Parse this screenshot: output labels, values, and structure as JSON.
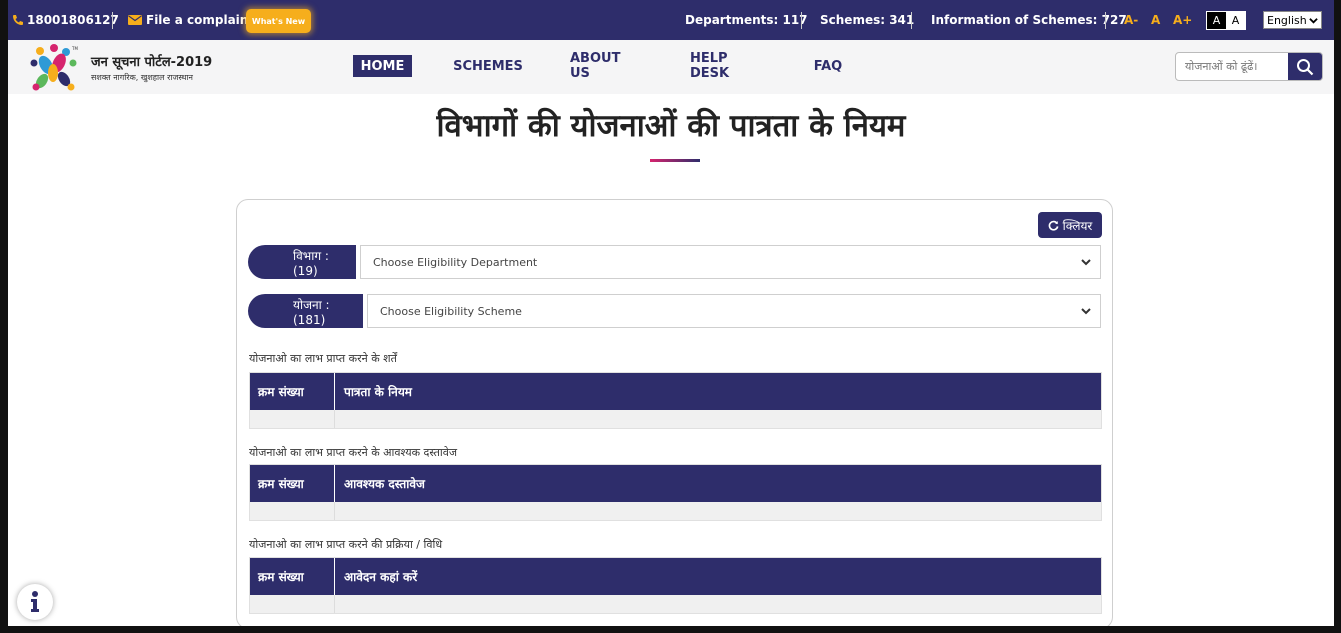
{
  "topbar": {
    "phone": "18001806127",
    "complaint": "File a complaint",
    "whats_new": "What's New",
    "departments": "Departments: 117",
    "schemes": "Schemes: 341",
    "information": "Information of Schemes: 727",
    "font_decrease": "A-",
    "font_normal": "A",
    "font_increase": "A+",
    "contrast_dark": "A",
    "contrast_light": "A",
    "language": "English"
  },
  "header": {
    "logo_title": "जन सूचना पोर्टल-2019",
    "logo_subtitle": "सशक्त नागरिक, खुशहाल राजस्थान",
    "nav": [
      "HOME",
      "SCHEMES",
      "ABOUT US",
      "HELP DESK",
      "FAQ"
    ],
    "search_placeholder": "योजनाओं को ढूंढें।"
  },
  "page": {
    "title": "विभागों की योजनाओं की पात्रता के नियम"
  },
  "filters": {
    "clear_label": "क्लियर",
    "department_label": "विभाग : (19)",
    "department_select": "Choose Eligibility Department",
    "scheme_label": "योजना : (181)",
    "scheme_select": "Choose Eligibility Scheme"
  },
  "sections": [
    {
      "title": "योजनाओ का लाभ प्राप्त करने के शर्तें",
      "col1": "क्रम संख्या",
      "col2": "पात्रता के नियम"
    },
    {
      "title": "योजनाओ का लाभ प्राप्त करने के आवश्यक दस्तावेज",
      "col1": "क्रम संख्या",
      "col2": "आवश्यक दस्तावेज"
    },
    {
      "title": "योजनाओ का लाभ प्राप्त करने की प्रक्रिया / विधि",
      "col1": "क्रम संख्या",
      "col2": "आवेदन कहां करें"
    }
  ],
  "colors": {
    "primary": "#2e2d6b",
    "accent": "#f6ae1c",
    "pink": "#d6246e"
  }
}
